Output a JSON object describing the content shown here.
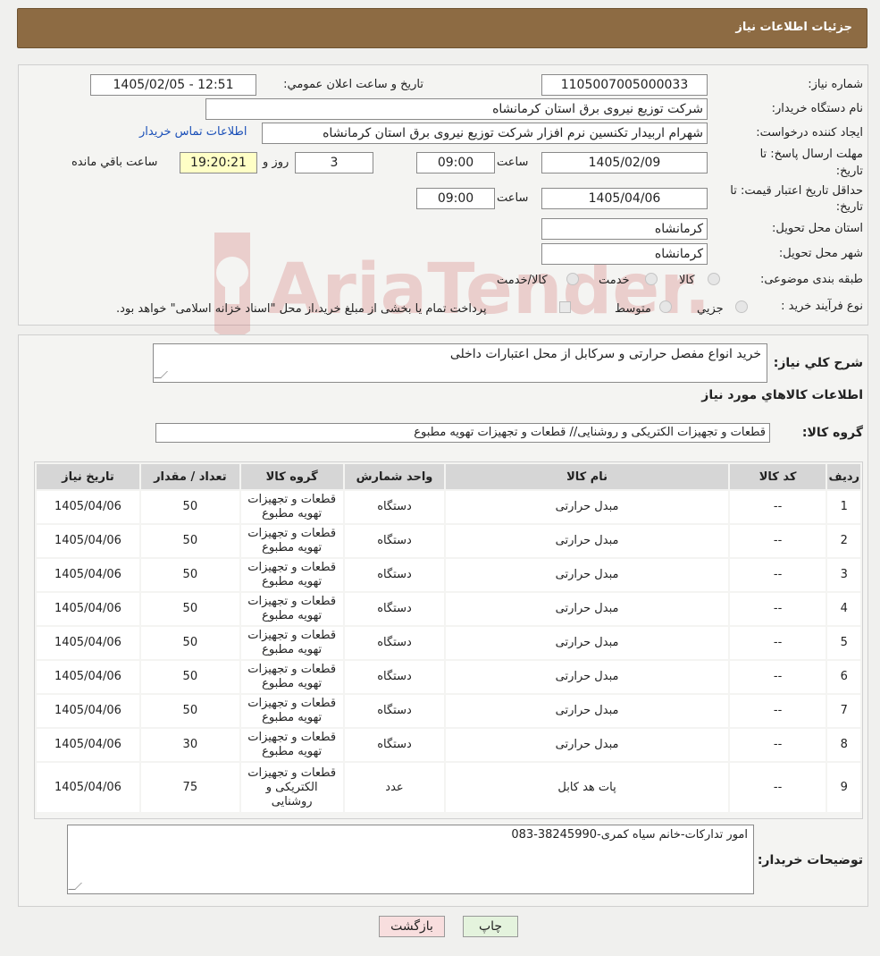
{
  "page": {
    "header_title": "جزئیات اطلاعات نیاز"
  },
  "form": {
    "need_number_label": "شماره نیاز:",
    "need_number": "1105007005000033",
    "announce_label": "تاریخ و ساعت اعلان عمومي:",
    "announce_value": "1405/02/05 - 12:51",
    "buyer_org_label": "نام دستگاه خریدار:",
    "buyer_org": "شرکت توزیع نیروی برق استان کرمانشاه",
    "creator_label": "ایجاد کننده درخواست:",
    "creator": "شهرام اربیدار تکنسین نرم افزار شرکت توزیع نیروی برق استان کرمانشاه",
    "contact_link": "اطلاعات تماس خریدار",
    "deadline_label_1": "مهلت ارسال پاسخ: تا",
    "deadline_label_2": "تاریخ:",
    "deadline_date": "1405/02/09",
    "time_label": "ساعت",
    "deadline_time": "09:00",
    "days_value": "3",
    "days_label": "روز و",
    "remaining_time": "19:20:21",
    "remaining_label": "ساعت باقي مانده",
    "validity_label_1": "حداقل تاریخ اعتبار قیمت: تا",
    "validity_label_2": "تاریخ:",
    "validity_date": "1405/04/06",
    "validity_time": "09:00",
    "province_label": "استان محل تحویل:",
    "province": "کرمانشاه",
    "city_label": "شهر محل تحویل:",
    "city": "کرمانشاه",
    "category_label": "طبقه بندی موضوعی:",
    "category_options": [
      "کالا",
      "خدمت",
      "کالا/خدمت"
    ],
    "process_label": "نوع فرآیند خرید :",
    "process_options": [
      "جزیي",
      "متوسط"
    ],
    "process_note": "پرداخت تمام یا بخشی از مبلغ خرید،از محل \"اسناد خزانه اسلامی\" خواهد بود."
  },
  "items_section": {
    "summary_label": "شرح کلي نیاز:",
    "summary": "خرید انواع مفصل حرارتی و سرکابل از محل اعتبارات داخلی",
    "goods_info_title": "اطلاعات کالاهاي مورد نیاز",
    "group_label": "گروه کالا:",
    "group_value": "قطعات و تجهیزات الکتریکی و روشنایی//  قطعات و تجهیزات تهویه مطبوع",
    "columns": [
      "ردیف",
      "کد کالا",
      "نام کالا",
      "واحد شمارش",
      "گروه کالا",
      "تعداد / مقدار",
      "تاریخ نیاز"
    ],
    "rows": [
      {
        "idx": "1",
        "code": "--",
        "name": "مبدل حرارتی",
        "unit": "دستگاه",
        "group_1": "قطعات و تجهیزات",
        "group_2": "تهویه مطبوع",
        "qty": "50",
        "date": "1405/04/06"
      },
      {
        "idx": "2",
        "code": "--",
        "name": "مبدل حرارتی",
        "unit": "دستگاه",
        "group_1": "قطعات و تجهیزات",
        "group_2": "تهویه مطبوع",
        "qty": "50",
        "date": "1405/04/06"
      },
      {
        "idx": "3",
        "code": "--",
        "name": "مبدل حرارتی",
        "unit": "دستگاه",
        "group_1": "قطعات و تجهیزات",
        "group_2": "تهویه مطبوع",
        "qty": "50",
        "date": "1405/04/06"
      },
      {
        "idx": "4",
        "code": "--",
        "name": "مبدل حرارتی",
        "unit": "دستگاه",
        "group_1": "قطعات و تجهیزات",
        "group_2": "تهویه مطبوع",
        "qty": "50",
        "date": "1405/04/06"
      },
      {
        "idx": "5",
        "code": "--",
        "name": "مبدل حرارتی",
        "unit": "دستگاه",
        "group_1": "قطعات و تجهیزات",
        "group_2": "تهویه مطبوع",
        "qty": "50",
        "date": "1405/04/06"
      },
      {
        "idx": "6",
        "code": "--",
        "name": "مبدل حرارتی",
        "unit": "دستگاه",
        "group_1": "قطعات و تجهیزات",
        "group_2": "تهویه مطبوع",
        "qty": "50",
        "date": "1405/04/06"
      },
      {
        "idx": "7",
        "code": "--",
        "name": "مبدل حرارتی",
        "unit": "دستگاه",
        "group_1": "قطعات و تجهیزات",
        "group_2": "تهویه مطبوع",
        "qty": "50",
        "date": "1405/04/06"
      },
      {
        "idx": "8",
        "code": "--",
        "name": "مبدل حرارتی",
        "unit": "دستگاه",
        "group_1": "قطعات و تجهیزات",
        "group_2": "تهویه مطبوع",
        "qty": "30",
        "date": "1405/04/06"
      },
      {
        "idx": "9",
        "code": "--",
        "name": "پات هد کابل",
        "unit": "عدد",
        "group_1": "قطعات و تجهیزات",
        "group_2": "الکتریکی و",
        "group_3": "روشنایی",
        "qty": "75",
        "date": "1405/04/06"
      }
    ],
    "buyer_notes_label": "توضیحات خریدار:",
    "buyer_notes": "امور تدارکات-خانم سیاه کمری-38245990-083"
  },
  "buttons": {
    "print": "چاپ",
    "back": "بازگشت"
  },
  "watermark": {
    "text": "AriaTender.neT",
    "color": "#c94a4a",
    "icon": "aria-tender-logo-icon"
  }
}
